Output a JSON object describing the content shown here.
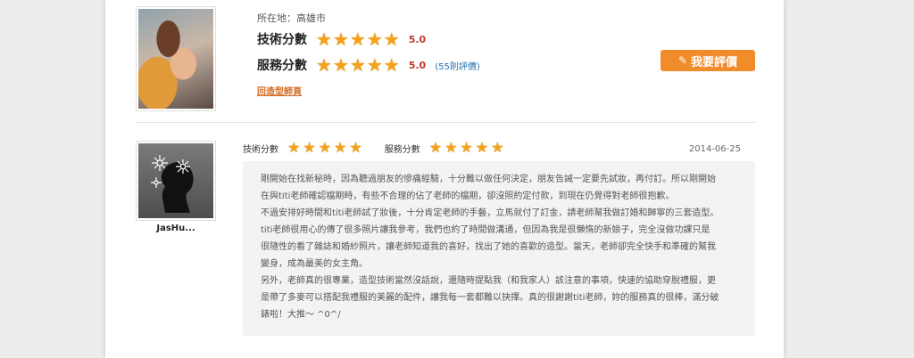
{
  "profile": {
    "location": "所在地：高雄市",
    "tech_label": "技術分數",
    "tech_score": "5.0",
    "tech_stars": 5,
    "service_label": "服務分數",
    "service_score": "5.0",
    "service_stars": 5,
    "review_count": "(55則評價)",
    "back_link": "回造型師頁",
    "review_button": "我要評價",
    "pencil_icon": "pencil-icon"
  },
  "review": {
    "username": "JasHu...",
    "tech_label": "技術分數",
    "tech_stars": 5,
    "service_label": "服務分數",
    "service_stars": 5,
    "date": "2014-06-25",
    "lines": [
      "剛開始在找新秘時，因為聽過朋友的慘痛經驗，十分難以做任何決定，朋友告誡一定要先試妝，再付訂。所以剛開始",
      "在與titi老師確認檔期時，有些不合理的佔了老師的檔期，卻沒照約定付款，到現在仍覺得對老師很抱歉。",
      "不過安排好時間和titi老師試了妝後，十分肯定老師的手藝，立馬就付了訂金，請老師幫我做訂婚和歸寧的三套造型。",
      "titi老師很用心的傳了很多照片讓我參考，我們也約了時間做溝通，但因為我是很懶惰的新娘子，完全沒做功課只是",
      "很隨性的看了雜誌和婚紗照片，讓老師知道我的喜好，找出了她的喜歡的造型。當天，老師卻完全快手和準確的幫我",
      "變身，成為最美的女主角。",
      "另外，老師真的很專業，造型技術當然沒話說，還隨時提點我（和我家人）該注意的事項，快速的協助穿脫禮服，更",
      "是帶了多麥可以搭配我禮服的美麗的配件，讓我每一套都難以抉擇。真的很謝謝titi老師，妳的服務真的很棒，滿分破",
      "錶啦！大推～ ^0^/"
    ]
  },
  "colors": {
    "star": "#f4a21c",
    "score": "#c0392b",
    "button": "#f08c2a",
    "link": "#d2691e",
    "count": "#1f6fb3"
  }
}
